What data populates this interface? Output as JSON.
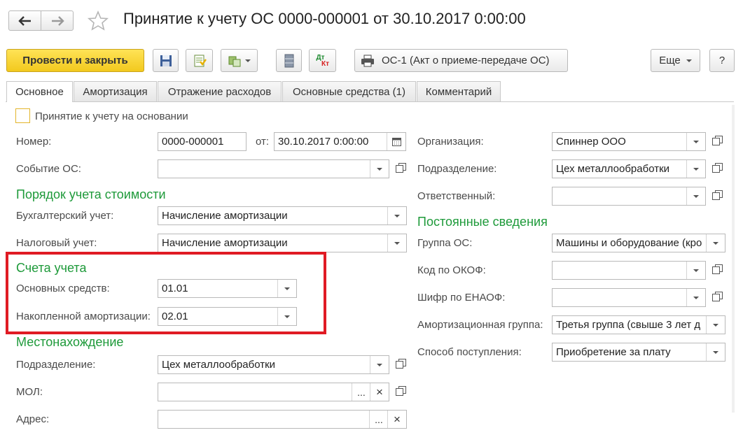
{
  "header": {
    "title": "Принятие к учету ОС 0000-000001 от 30.10.2017 0:00:00"
  },
  "toolbar": {
    "post_close": "Провести и закрыть",
    "print_form": "ОС-1 (Акт о приеме-передаче ОС)",
    "more": "Еще",
    "help": "?",
    "dt_kt_top": "Дт",
    "dt_kt_bottom": "Кт"
  },
  "tabs": [
    {
      "label": "Основное"
    },
    {
      "label": "Амортизация"
    },
    {
      "label": "Отражение расходов"
    },
    {
      "label": "Основные средства (1)"
    },
    {
      "label": "Комментарий"
    }
  ],
  "form": {
    "basis_checkbox": "Принятие к учету на основании",
    "number_label": "Номер:",
    "number_value": "0000-000001",
    "from_label": "от:",
    "date_value": "30.10.2017  0:00:00",
    "event_label": "Событие ОС:",
    "event_value": "",
    "cost_section": "Порядок учета стоимости",
    "accounting_label": "Бухгалтерский учет:",
    "accounting_value": "Начисление амортизации",
    "tax_label": "Налоговый учет:",
    "tax_value": "Начисление амортизации",
    "accounts_section": "Счета учета",
    "fixed_assets_label": "Основных средств:",
    "fixed_assets_value": "01.01",
    "depreciation_label": "Накопленной амортизации:",
    "depreciation_value": "02.01",
    "location_section": "Местонахождение",
    "division_label": "Подразделение:",
    "division_value": "Цех металлообработки",
    "mol_label": "МОЛ:",
    "mol_value": "",
    "address_label": "Адрес:",
    "address_value": "",
    "org_label": "Организация:",
    "org_value": "Спиннер ООО",
    "right_division_label": "Подразделение:",
    "right_division_value": "Цех металлообработки",
    "responsible_label": "Ответственный:",
    "responsible_value": "",
    "permanent_section": "Постоянные сведения",
    "group_label": "Группа ОС:",
    "group_value": "Машины и оборудование (кро",
    "okof_label": "Код по ОКОФ:",
    "okof_value": "",
    "enaof_label": "Шифр по ЕНАОФ:",
    "enaof_value": "",
    "amort_group_label": "Амортизационная группа:",
    "amort_group_value": "Третья группа (свыше 3 лет д",
    "receipt_label": "Способ поступления:",
    "receipt_value": "Приобретение за плату",
    "ellipsis": "...",
    "clear": "×"
  },
  "colors": {
    "accent_button": "#f5d22a",
    "section_green": "#1e9a3a",
    "highlight_red": "#e01b24"
  }
}
